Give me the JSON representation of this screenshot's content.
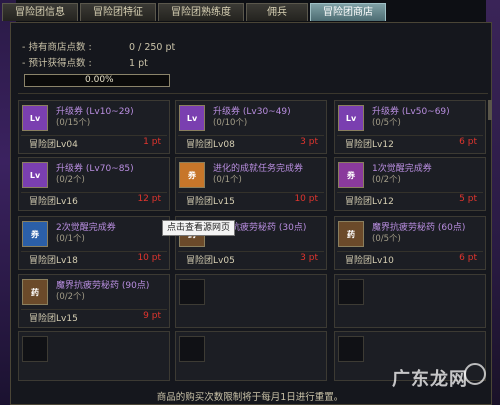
{
  "tabs": [
    "冒险团信息",
    "冒险团特征",
    "冒险团熟练度",
    "佣兵",
    "冒险团商店"
  ],
  "active_tab": 4,
  "info": {
    "points_label": "- 持有商店点数 :",
    "points_value": "0 / 250 pt",
    "expected_label": "- 预计获得点数 :",
    "expected_value": "1 pt",
    "progress_text": "0.00%",
    "progress_fraction": 0.0
  },
  "items": [
    {
      "name": "升级券 (Lv10~29)",
      "count": "(0/15个)",
      "level": "冒险团Lv04",
      "price": "1 pt",
      "icon": "level-up-ticket-icon",
      "icon_text": "Lv",
      "icon_color": "#7a3fb0"
    },
    {
      "name": "升级券 (Lv30~49)",
      "count": "(0/10个)",
      "level": "冒险团Lv08",
      "price": "3 pt",
      "icon": "level-up-ticket-icon",
      "icon_text": "Lv",
      "icon_color": "#7a3fb0"
    },
    {
      "name": "升级券 (Lv50~69)",
      "count": "(0/5个)",
      "level": "冒险团Lv12",
      "price": "6 pt",
      "icon": "level-up-ticket-icon",
      "icon_text": "Lv",
      "icon_color": "#7a3fb0"
    },
    {
      "name": "升级券 (Lv70~85)",
      "count": "(0/2个)",
      "level": "冒险团Lv16",
      "price": "12 pt",
      "icon": "level-up-ticket-icon",
      "icon_text": "Lv",
      "icon_color": "#7a3fb0"
    },
    {
      "name": "进化的成就任务完成券",
      "count": "(0/1个)",
      "level": "冒险团Lv15",
      "price": "10 pt",
      "icon": "quest-complete-ticket-icon",
      "icon_text": "券",
      "icon_color": "#c7762a"
    },
    {
      "name": "1次觉醒完成券",
      "count": "(0/2个)",
      "level": "冒险团Lv12",
      "price": "5 pt",
      "icon": "awakening-ticket-icon",
      "icon_text": "券",
      "icon_color": "#8a3a9c"
    },
    {
      "name": "2次觉醒完成券",
      "count": "(0/1个)",
      "level": "冒险团Lv18",
      "price": "10 pt",
      "icon": "awakening-ticket-icon",
      "icon_text": "券",
      "icon_color": "#2b5fa8"
    },
    {
      "name": "魔界抗疲劳秘药 (30点)",
      "count": "",
      "level": "冒险团Lv05",
      "price": "3 pt",
      "icon": "potion-icon",
      "icon_text": "药",
      "icon_color": "#6b4a2a"
    },
    {
      "name": "魔界抗疲劳秘药 (60点)",
      "count": "(0/5个)",
      "level": "冒险团Lv10",
      "price": "6 pt",
      "icon": "potion-icon",
      "icon_text": "药",
      "icon_color": "#6b4a2a"
    },
    {
      "name": "魔界抗疲劳秘药 (90点)",
      "count": "(0/2个)",
      "level": "冒险团Lv15",
      "price": "9 pt",
      "icon": "potion-icon",
      "icon_text": "药",
      "icon_color": "#6b4a2a"
    }
  ],
  "tooltip": "点击查看源网页",
  "footer": "商品的购买次数限制将于每月1日进行重置。",
  "watermark": "广东龙网"
}
